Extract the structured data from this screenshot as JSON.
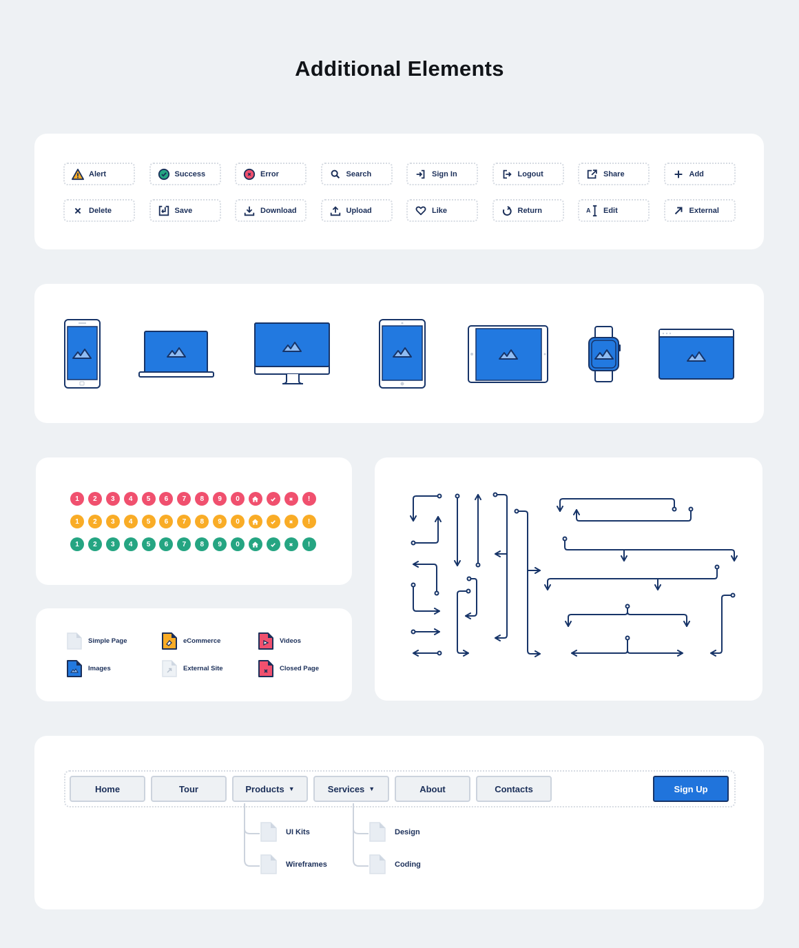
{
  "title": "Additional Elements",
  "colors": {
    "navy": "#1b2f59",
    "blue": "#2074dc",
    "red": "#f0506e",
    "orange": "#f9ac26",
    "green": "#25a582",
    "light_gray": "#e4e9f0"
  },
  "icon_buttons": [
    {
      "label": "Alert",
      "icon": "alert-triangle-icon"
    },
    {
      "label": "Success",
      "icon": "check-circle-icon"
    },
    {
      "label": "Error",
      "icon": "error-circle-icon"
    },
    {
      "label": "Search",
      "icon": "search-icon"
    },
    {
      "label": "Sign In",
      "icon": "sign-in-icon"
    },
    {
      "label": "Logout",
      "icon": "logout-icon"
    },
    {
      "label": "Share",
      "icon": "share-icon"
    },
    {
      "label": "Add",
      "icon": "plus-icon"
    },
    {
      "label": "Delete",
      "icon": "x-icon"
    },
    {
      "label": "Save",
      "icon": "save-icon"
    },
    {
      "label": "Download",
      "icon": "download-icon"
    },
    {
      "label": "Upload",
      "icon": "upload-icon"
    },
    {
      "label": "Like",
      "icon": "heart-icon"
    },
    {
      "label": "Return",
      "icon": "return-icon"
    },
    {
      "label": "Edit",
      "icon": "text-cursor-icon"
    },
    {
      "label": "External",
      "icon": "arrow-up-right-icon"
    }
  ],
  "devices": [
    "phone",
    "laptop",
    "desktop-monitor",
    "tablet-portrait",
    "tablet-landscape",
    "smartwatch",
    "browser-window"
  ],
  "badges": {
    "symbols": [
      "1",
      "2",
      "3",
      "4",
      "5",
      "6",
      "7",
      "8",
      "9",
      "0",
      "home",
      "check",
      "x",
      "!"
    ],
    "rows": [
      "red",
      "orange",
      "green"
    ]
  },
  "files": [
    {
      "label": "Simple Page",
      "type": "simple"
    },
    {
      "label": "eCommerce",
      "type": "ecommerce"
    },
    {
      "label": "Videos",
      "type": "videos"
    },
    {
      "label": "Images",
      "type": "images"
    },
    {
      "label": "External Site",
      "type": "external"
    },
    {
      "label": "Closed Page",
      "type": "closed"
    }
  ],
  "nav": {
    "items": [
      {
        "label": "Home",
        "caret": ""
      },
      {
        "label": "Tour",
        "caret": ""
      },
      {
        "label": "Products",
        "caret": "▼"
      },
      {
        "label": "Services",
        "caret": "▼"
      },
      {
        "label": "About",
        "caret": ""
      },
      {
        "label": "Contacts",
        "caret": ""
      }
    ],
    "signup_label": "Sign Up",
    "submenus": {
      "products": [
        "UI Kits",
        "Wireframes"
      ],
      "services": [
        "Design",
        "Coding"
      ]
    }
  }
}
